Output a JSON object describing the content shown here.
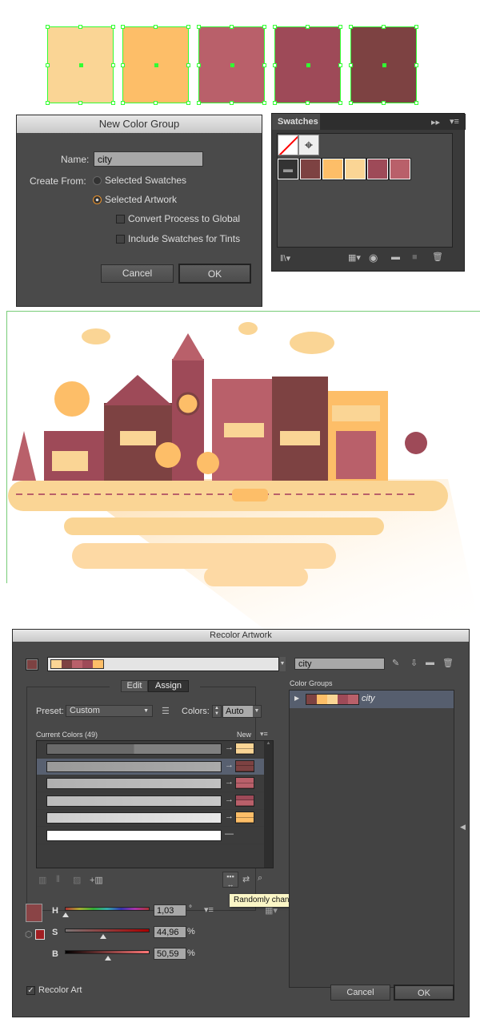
{
  "artboard_swatches": [
    {
      "color": "#FAD595"
    },
    {
      "color": "#FDBE68"
    },
    {
      "color": "#B9606A"
    },
    {
      "color": "#9E4A58"
    },
    {
      "color": "#7D4242"
    }
  ],
  "new_color_group": {
    "title": "New Color Group",
    "name_label": "Name:",
    "name_value": "city",
    "create_from_label": "Create From:",
    "options": [
      {
        "label": "Selected Swatches",
        "selected": false
      },
      {
        "label": "Selected Artwork",
        "selected": true
      }
    ],
    "checkboxes": [
      {
        "label": "Convert Process to Global",
        "checked": false
      },
      {
        "label": "Include Swatches for Tints",
        "checked": false
      }
    ],
    "cancel": "Cancel",
    "ok": "OK"
  },
  "swatches_panel": {
    "tab": "Swatches",
    "group_colors": [
      "#7D4242",
      "#FDBE68",
      "#FAD595",
      "#9E4A58",
      "#B9606A"
    ]
  },
  "recolor": {
    "title": "Recolor Artwork",
    "group_colors": [
      "#FAD595",
      "#7D4242",
      "#B9606A",
      "#9E4A58",
      "#FDBE68"
    ],
    "name_value": "city",
    "tabs": [
      {
        "label": "Edit",
        "active": false
      },
      {
        "label": "Assign",
        "active": true
      }
    ],
    "preset_label": "Preset:",
    "preset_value": "Custom",
    "colors_label": "Colors:",
    "colors_value": "Auto",
    "current_colors_label": "Current Colors (49)",
    "new_label": "New",
    "rows": [
      {
        "new": [
          "#FAD595",
          "#FAD595"
        ],
        "selected": false,
        "bar": "linear-gradient(90deg,#6a6a6a 50%,#808080 50%)"
      },
      {
        "new": [
          "#7D4242",
          "#7D4242"
        ],
        "selected": true,
        "bar": "linear-gradient(90deg,#999,#aaa)"
      },
      {
        "new": [
          "#B9606A",
          "#B9606A"
        ],
        "selected": false,
        "bar": "linear-gradient(90deg,#b0b0b0,#c0c0c0)"
      },
      {
        "new": [
          "#9E4A58",
          "#B9606A"
        ],
        "selected": false,
        "bar": "linear-gradient(90deg,#bbb,#c8c8c8)"
      },
      {
        "new": [
          "#FDBE68",
          "#FDBE68"
        ],
        "selected": false,
        "bar": "linear-gradient(90deg,#ccc,#e8e8e8)"
      },
      {
        "new": null,
        "selected": false,
        "bar": "#fff"
      }
    ],
    "tooltip": "Randomly change color order",
    "current_color": "#8A4446",
    "h_label": "H",
    "h_value": "1,03",
    "h_unit": "°",
    "h_pct": 0.003,
    "s_label": "S",
    "s_value": "44,96",
    "s_unit": "%",
    "s_pct": 0.4496,
    "b_label": "B",
    "b_value": "50,59",
    "b_unit": "%",
    "b_pct": 0.5059,
    "color_groups_label": "Color Groups",
    "color_group": {
      "name": "city",
      "colors": [
        "#7D4242",
        "#FDBE68",
        "#FAD595",
        "#9E4A58",
        "#B9606A"
      ]
    },
    "recolor_art_label": "Recolor Art",
    "recolor_art_checked": true,
    "cancel": "Cancel",
    "ok": "OK"
  }
}
